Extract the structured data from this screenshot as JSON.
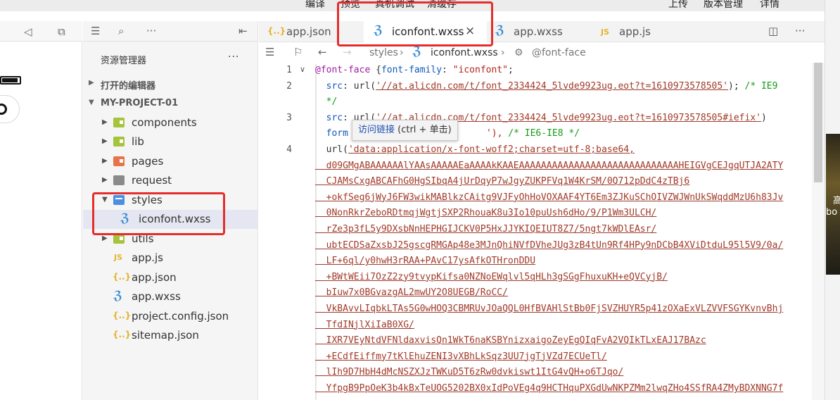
{
  "menu": {
    "compile": "编译",
    "preview": "预览",
    "remote_debug": "真机调试",
    "clear_cache": "清缓存",
    "upload": "上传",
    "version": "版本管理",
    "details": "详情"
  },
  "desktop_edge": {
    "text1": "高",
    "text2": "bo"
  },
  "explorer": {
    "title": "资源管理器",
    "more": "···",
    "open_editors": "打开的编辑器",
    "project": "MY-PROJECT-01",
    "items": [
      {
        "label": "components",
        "type": "folder-green"
      },
      {
        "label": "lib",
        "type": "folder-green"
      },
      {
        "label": "pages",
        "type": "folder-orange"
      },
      {
        "label": "request",
        "type": "folder-gray"
      },
      {
        "label": "styles",
        "type": "folder-blue-open"
      },
      {
        "label": "iconfont.wxss",
        "type": "wxss"
      },
      {
        "label": "utils",
        "type": "folder-green"
      },
      {
        "label": "app.js",
        "type": "js"
      },
      {
        "label": "app.json",
        "type": "json"
      },
      {
        "label": "app.wxss",
        "type": "wxss"
      },
      {
        "label": "project.config.json",
        "type": "json"
      },
      {
        "label": "sitemap.json",
        "type": "json"
      }
    ]
  },
  "tabs": [
    {
      "label": "app.json",
      "icon": "json-icon"
    },
    {
      "label": "iconfont.wxss",
      "icon": "css-icon",
      "active": true
    },
    {
      "label": "app.wxss",
      "icon": "css-icon"
    },
    {
      "label": "app.js",
      "icon": "js-icon"
    }
  ],
  "breadcrumb": {
    "folder": "styles",
    "file": "iconfont.wxss",
    "symbol": "@font-face"
  },
  "tooltip": {
    "link": "访问链接",
    "hint": " (ctrl + 单击)"
  },
  "editor": {
    "line_numbers": [
      "1",
      "2",
      "3",
      "4"
    ],
    "lines": {
      "l1a": "@font-face",
      "l1b": " {",
      "l1c": "font-family",
      "l1d": ": ",
      "l1e": "\"iconfont\"",
      "l1f": ";",
      "l2a": "  src",
      "l2b": ": url(",
      "l2c": "'//at.alicdn.com/t/font_2334424_5lvde9923ug.eot?t=1610973578505'",
      "l2d": "); ",
      "l2e": "/* IE9",
      "l2f": "  */",
      "l3a": "  src",
      "l3b": ": url(",
      "l3c": "'//at.alicdn.com/t/font_2334424_5lvde9923ug.eot?t=1610973578505#iefix'",
      "l3d": ")",
      "l3e": "  form",
      "l3f": "'), ",
      "l3g": "/* IE6-IE8 */",
      "l4a": "  url(",
      "l4b": "'data:application/x-font-woff2;charset=utf-8;base64,"
    },
    "base64_lines": [
      "  d09GMgABAAAAAAlYAAsAAAAAEaAAAAkKAAEAAAAAAAAAAAAAAAAAAAAAAAAAAAAAHEIGVgCEJgqUTJA2ATY",
      "  CJAMsCxgABCAFhG0HgSIbqA4jUrDqyP7wJgyZUKPFVq1W4KrSM/0Q712pDdC4zTBj6",
      "  +okfSeg6jWyJ6FW3wikMABlkzCAitg9VJFyOhHoVOXAAF4YT6Em3ZJKuSChOIVZWJWnUkSWqddMzU6h83Jv",
      "  0NonRkrZeboRDtmqjWgtjSXP2RhouaK8u3Io10puUsh6dHo/9/P1Wm3ULCH/",
      "  rZe3p3fL5y9DXsbNnHEPHGIJCKV0P5HxJJYKIQEIUT8Z7/5ngt7kWDlEAsr/",
      "  ubtECDSaZxsbJ25gscgRMGAp48e3MJnQhiNVfDVheJUg3zB4tUn9Rf4HPy9nDCbB4XViDtduL95l5V9/0a/",
      "  LF+6ql/y0hwH3rRAA+PAvC17ysAfkOTHronDDU",
      "  +BWtWEii7OzZ2zy9tvypKifsa0NZNoEWqlvl5qHLh3gSGgFhuxuKH+eQVCyjB/",
      "  bIuw7x0BGvazgAL2mwUY2O8UEGB/RoCC/",
      "  VkBAvvLIqbkLTAs5G0wHOQ3CBMRUvJOaQQL0HfBVAHlStBb0FjSVZHUYR5p41zOXaExVLZVVFSGYKvnvBhj",
      "  TfdINjlXiIaB0XG/",
      "  IXR7VEyNtdVFNldaxvisQn1WkT6naKSBYnizxaigoZeyEgQIqFvA2VQIkTLxEAJ17BAzc",
      "  +ECdfEiffmy7tKlEhuZENI3vXBhLkSqz3UU7jgTjVZd7ECUeTl/",
      "  lIh9D7HbH4dMcNSZXJzTWKuD5T6zRw0dvkiswt1ItG4vQH+o6TJqo/",
      "  YfpgB9PpOeK3b4kBxTeUOG5202BX0xIdPoVEg4q9HCTHquPXGdUwNKPZMm2lwqZHo4SSfRA4ZMyBDXNNG7f"
    ]
  }
}
